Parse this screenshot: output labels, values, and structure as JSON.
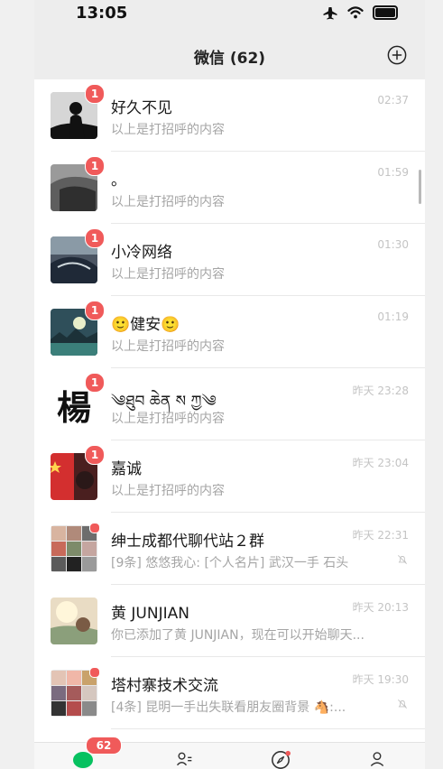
{
  "status_bar": {
    "time": "13:05"
  },
  "nav": {
    "title": "微信 (62)"
  },
  "chats": [
    {
      "name": "好久不见",
      "preview": "以上是打招呼的内容",
      "time": "02:37",
      "badge": "1"
    },
    {
      "name": "。",
      "preview": "以上是打招呼的内容",
      "time": "01:59",
      "badge": "1"
    },
    {
      "name": "小冷网络",
      "preview": "以上是打招呼的内容",
      "time": "01:30",
      "badge": "1"
    },
    {
      "name": "🙂健安🙂",
      "preview": "以上是打招呼的内容",
      "time": "01:19",
      "badge": "1"
    },
    {
      "name": "༄ཐུབ ཆེན ས ཀྱ༄",
      "preview": "以上是打招呼的内容",
      "time": "昨天 23:28",
      "badge": "1"
    },
    {
      "name": "嘉诚",
      "preview": "以上是打招呼的内容",
      "time": "昨天 23:04",
      "badge": "1"
    },
    {
      "name": "绅士成都代聊代站２群",
      "preview": "[9条] 悠悠我心: [个人名片] 武汉一手  石头",
      "time": "昨天 22:31"
    },
    {
      "name": "黄 JUNJIAN",
      "preview": "你已添加了黄 JUNJIAN，现在可以开始聊天...",
      "time": "昨天 20:13"
    },
    {
      "name": "塔村寨技术交流",
      "preview": "[4条] 昆明一手出失联看朋友圈背景 🐴:...",
      "time": "昨天 19:30"
    }
  ],
  "avatar_labels": {
    "yang": "楊"
  },
  "tabbar": {
    "badge": "62"
  },
  "colors": {
    "badge": "#f05a5a",
    "wechat_green": "#07c160"
  }
}
